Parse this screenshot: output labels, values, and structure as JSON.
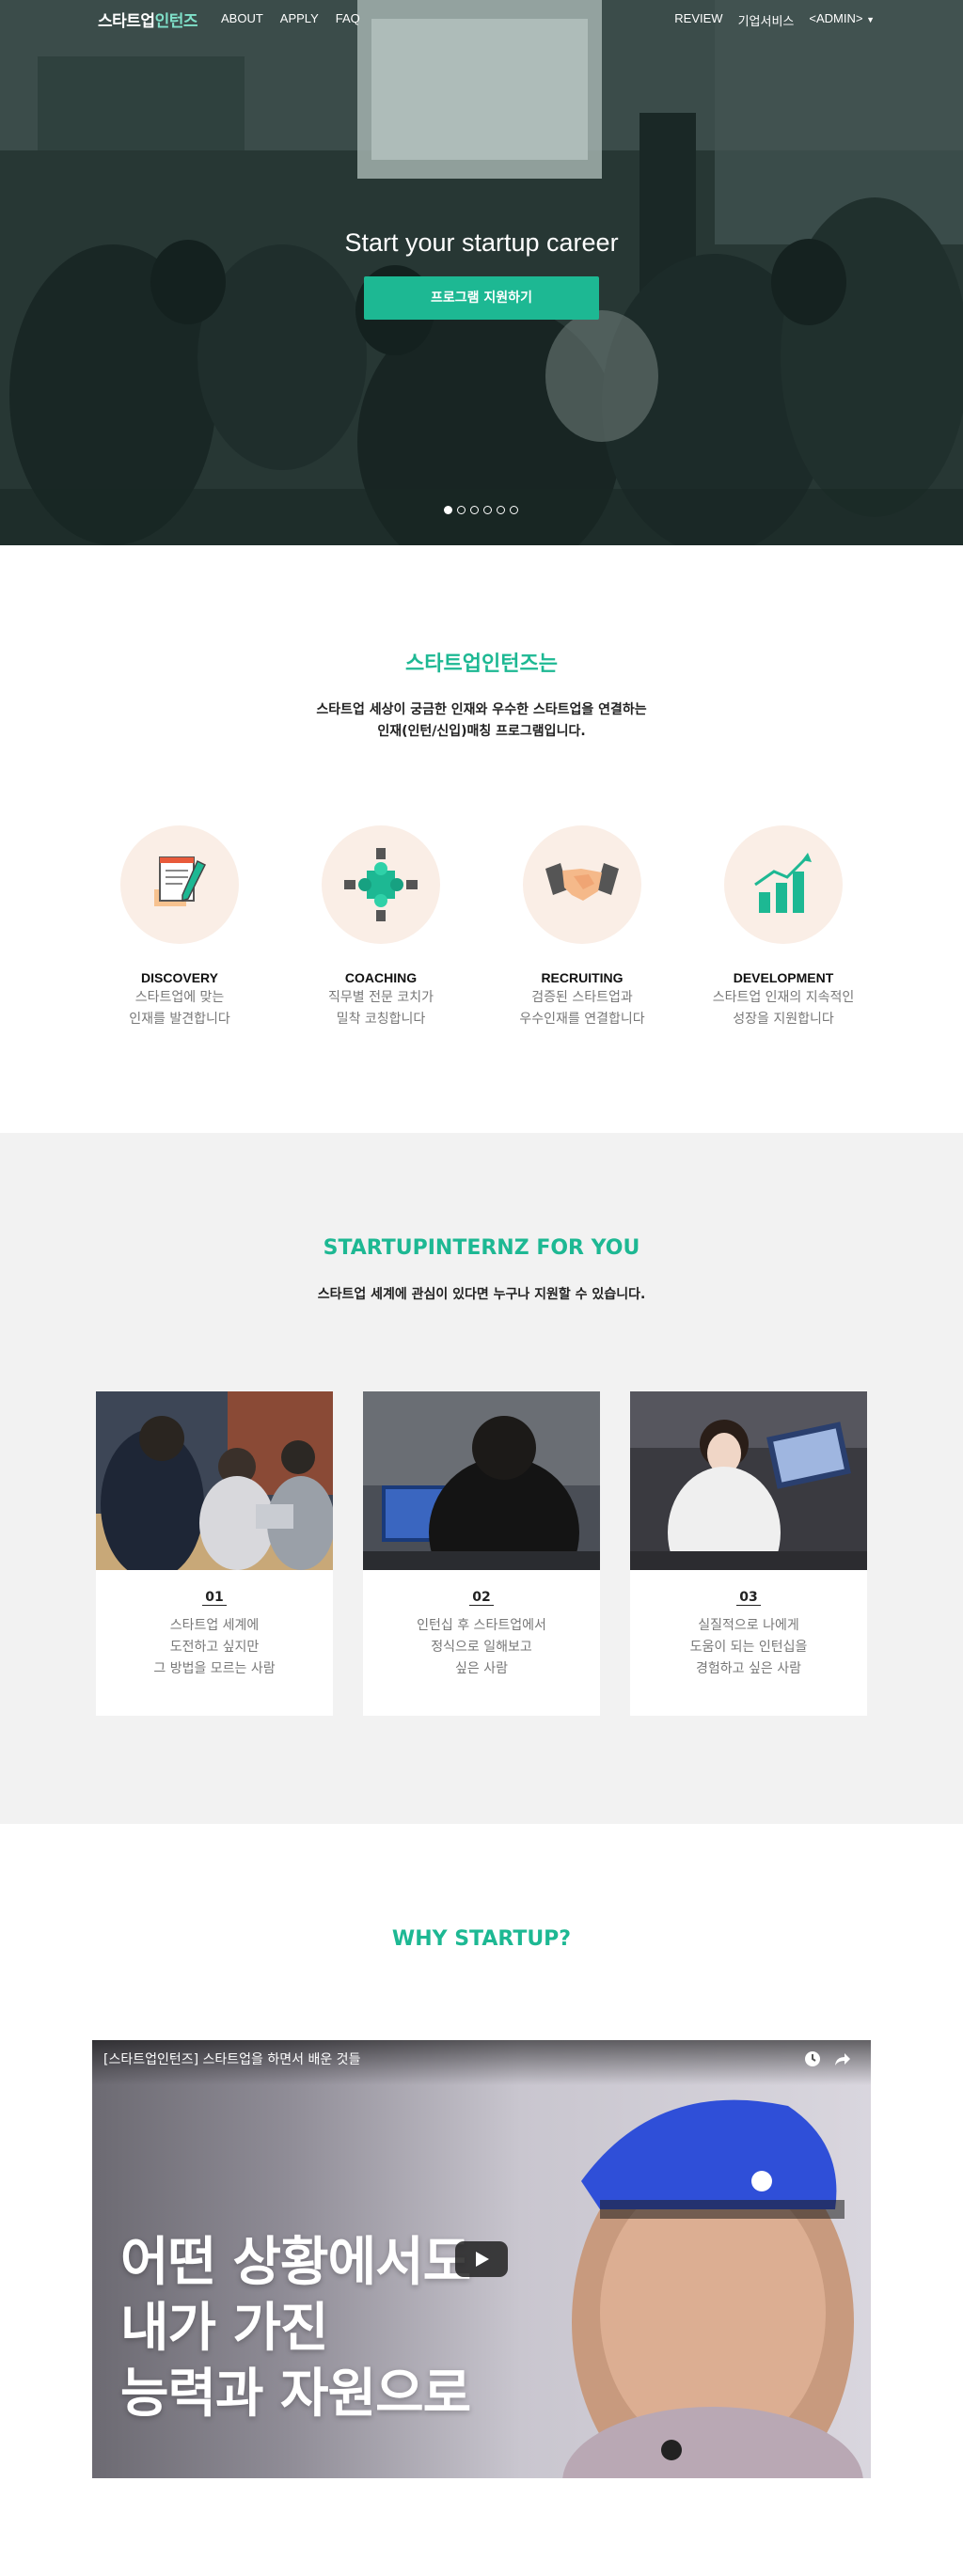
{
  "nav": {
    "logo_part1": "스타트업",
    "logo_part2": "인턴즈",
    "left_links": [
      "ABOUT",
      "APPLY",
      "FAQ"
    ],
    "right_links": [
      "REVIEW",
      "기업서비스",
      "<ADMIN>"
    ]
  },
  "hero": {
    "title": "Start your startup career",
    "button_label": "프로그램 지원하기",
    "slides_total": 6,
    "slide_active": 1
  },
  "about": {
    "title": "스타트업인턴즈는",
    "subtitle_line1": "스타트업 세상이 궁금한 인재와 우수한 스타트업을 연결하는",
    "subtitle_line2": "인재(인턴/신입)매칭 프로그램입니다.",
    "features": [
      {
        "name": "DISCOVERY",
        "line1": "스타트업에 맞는",
        "line2": "인재를 발견합니다",
        "icon": "document-pencil-icon"
      },
      {
        "name": "COACHING",
        "line1": "직무별 전문 코치가",
        "line2": "밀착 코칭합니다",
        "icon": "puzzle-icon"
      },
      {
        "name": "RECRUITING",
        "line1": "검증된 스타트업과",
        "line2": "우수인재를 연결합니다",
        "icon": "handshake-icon"
      },
      {
        "name": "DEVELOPMENT",
        "line1": "스타트업 인재의 지속적인",
        "line2": "성장을 지원합니다",
        "icon": "growth-chart-icon"
      }
    ]
  },
  "for_you": {
    "title": "STARTUPINTERNZ FOR YOU",
    "subtitle": "스타트업 세계에 관심이 있다면 누구나 지원할 수 있습니다.",
    "cards": [
      {
        "num": "01",
        "line1": "스타트업 세계에",
        "line2": "도전하고 싶지만",
        "line3": "그 방법을 모르는 사람"
      },
      {
        "num": "02",
        "line1": "인턴십 후 스타트업에서",
        "line2": "정식으로 일해보고",
        "line3": "싶은 사람"
      },
      {
        "num": "03",
        "line1": "실질적으로 나에게",
        "line2": "도움이 되는 인턴십을",
        "line3": "경험하고 싶은 사람"
      }
    ]
  },
  "why": {
    "title": "WHY STARTUP?",
    "video_title": "[스타트업인턴즈] 스타트업을 하면서 배운 것들",
    "video_text_line1": "어떤 상황에서도",
    "video_text_line2": "내가 가진",
    "video_text_line3": "능력과 자원으로"
  },
  "colors": {
    "accent": "#1db893",
    "gray_band": "#f2f2f2",
    "icon_bg": "#faeee6"
  }
}
